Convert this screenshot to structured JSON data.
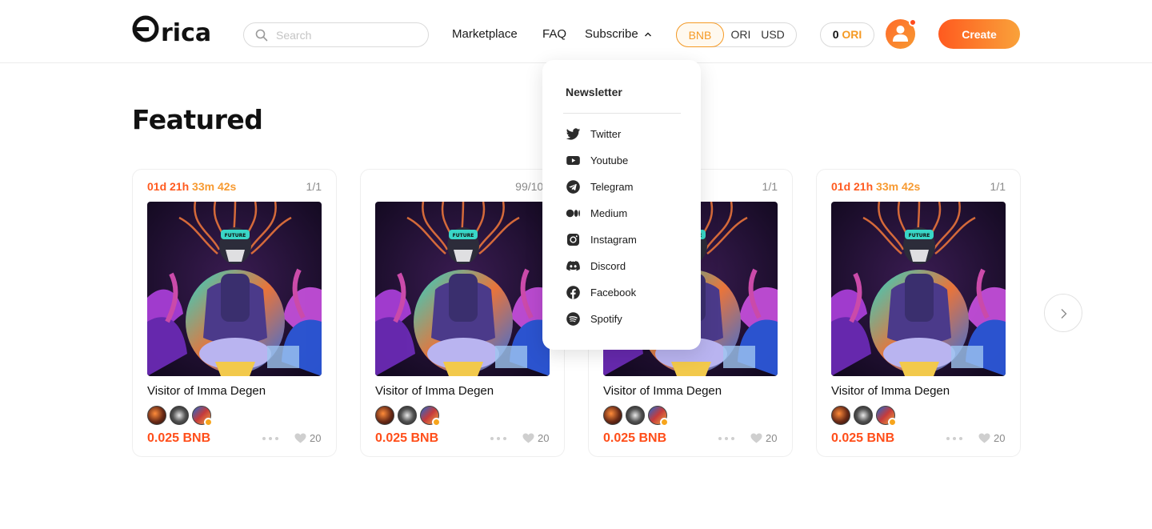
{
  "header": {
    "logo_text": "rica",
    "search": {
      "placeholder": "Search",
      "value": ""
    },
    "nav": [
      {
        "label": "Marketplace"
      },
      {
        "label": "FAQ"
      },
      {
        "label": "Subscribe",
        "icon": "chevron-up-icon"
      }
    ],
    "currencies": [
      {
        "label": "BNB",
        "selected": true
      },
      {
        "label": "ORI",
        "selected": false
      },
      {
        "label": "USD",
        "selected": false
      }
    ],
    "balance": {
      "amount": "0",
      "currency": "ORI"
    },
    "avatar": {
      "icon": "user-icon",
      "has_notification": true
    },
    "create_label": "Create"
  },
  "featured": {
    "title": "Featured",
    "cards": [
      {
        "timer_a": "01d 21h",
        "timer_b": "33m 42s",
        "edition": "1/1",
        "title": "Visitor of Imma Degen",
        "price": "0.025 BNB",
        "likes": "20"
      },
      {
        "timer_a": "",
        "timer_b": "",
        "edition": "99/100",
        "title": "Visitor of Imma Degen",
        "price": "0.025 BNB",
        "likes": "20"
      },
      {
        "timer_a": "",
        "timer_b": "",
        "edition": "1/1",
        "title": "Visitor of Imma Degen",
        "price": "0.025 BNB",
        "likes": "20"
      },
      {
        "timer_a": "01d 21h",
        "timer_b": "33m 42s",
        "edition": "1/1",
        "title": "Visitor of Imma Degen",
        "price": "0.025 BNB",
        "likes": "20"
      }
    ],
    "next_icon": "chevron-right-icon"
  },
  "subscribe_dropdown": {
    "title": "Newsletter",
    "items": [
      {
        "label": "Twitter",
        "icon": "twitter-icon"
      },
      {
        "label": "Youtube",
        "icon": "youtube-icon"
      },
      {
        "label": "Telegram",
        "icon": "telegram-icon"
      },
      {
        "label": "Medium",
        "icon": "medium-icon"
      },
      {
        "label": "Instagram",
        "icon": "instagram-icon"
      },
      {
        "label": "Discord",
        "icon": "discord-icon"
      },
      {
        "label": "Facebook",
        "icon": "facebook-icon"
      },
      {
        "label": "Spotify",
        "icon": "spotify-icon"
      }
    ]
  },
  "colors": {
    "accent_orange": "#ff5a1f",
    "accent_amber": "#f79a31",
    "price_red": "#ff4e1a"
  }
}
